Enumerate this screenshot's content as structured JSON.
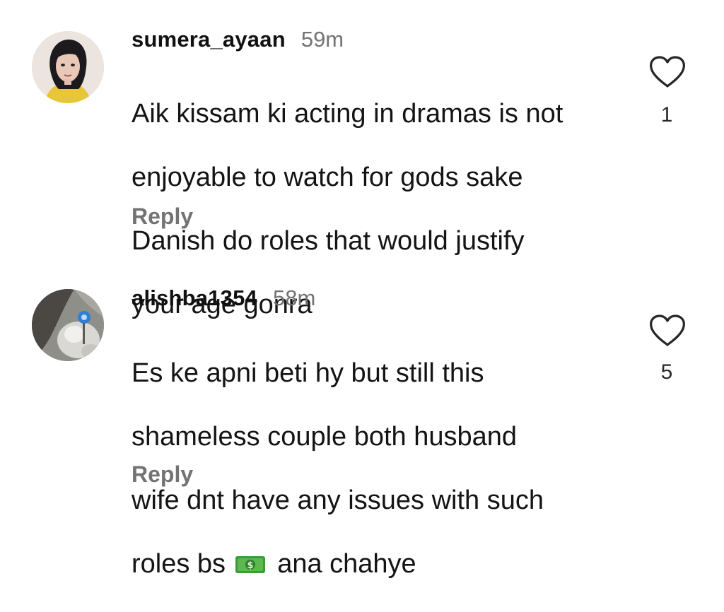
{
  "comments": [
    {
      "username": "sumera_ayaan",
      "time": "59m",
      "text_lines": [
        "Aik kissam ki acting in dramas is not",
        "enjoyable to watch for gods sake",
        "Danish do roles that would justify",
        "your age gonra"
      ],
      "reply_label": "Reply",
      "like_count": "1"
    },
    {
      "username": "alishba1354",
      "time": "58m",
      "text_lines": [
        "Es ke apni beti hy but still this",
        "shameless couple both husband",
        "wife dnt have any issues with such"
      ],
      "last_line_before_emoji": "roles bs",
      "emoji": "money-emoji",
      "last_line_after_emoji": "ana chahye",
      "reply_label": "Reply",
      "like_count": "5"
    }
  ],
  "colors": {
    "text": "#141414",
    "muted": "#737373",
    "heart_outline": "#262626"
  }
}
